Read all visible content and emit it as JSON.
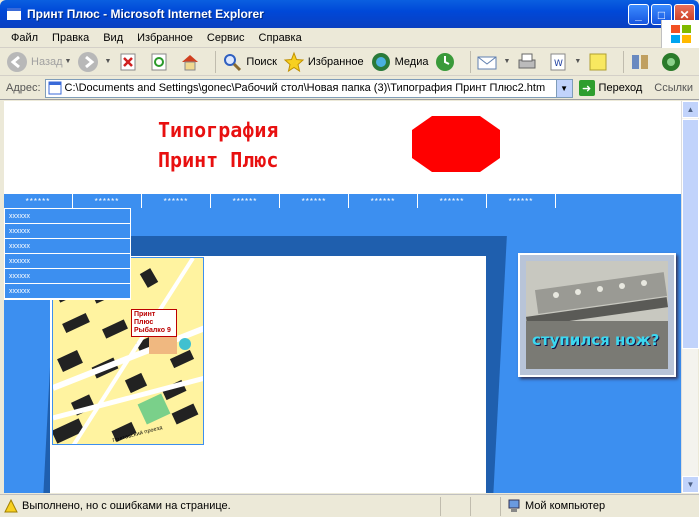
{
  "window": {
    "title": "Принт Плюс - Microsoft Internet Explorer"
  },
  "menu": [
    "Файл",
    "Правка",
    "Вид",
    "Избранное",
    "Сервис",
    "Справка"
  ],
  "toolbar": {
    "back": "Назад",
    "search": "Поиск",
    "favorites": "Избранное",
    "media": "Медиа"
  },
  "address": {
    "label": "Адрес:",
    "url": "C:\\Documents and Settings\\gonec\\Рабочий стол\\Новая папка (3)\\Типография Принт Плюс2.htm",
    "go": "Переход",
    "links": "Ссылки"
  },
  "page": {
    "logo_line1": "Типография",
    "logo_line2": "Принт Плюс",
    "nav": [
      "******",
      "******",
      "******",
      "******",
      "******",
      "******",
      "******",
      "******"
    ],
    "dropdown": [
      "xxxxxx",
      "xxxxxx",
      "xxxxxx",
      "xxxxxx",
      "xxxxxx",
      "xxxxxx"
    ],
    "map_label_1": "Принт Плюс",
    "map_label_2": "Рыбалко 9",
    "map_street": "Полтавский проезд",
    "photo_caption": "ступился нож?"
  },
  "status": {
    "text": "Выполнено, но с ошибками на странице.",
    "zone": "Мой компьютер"
  },
  "colors": {
    "accent": "#3c8ff0",
    "logo": "#e81010",
    "title_bar": "#0054e3"
  }
}
